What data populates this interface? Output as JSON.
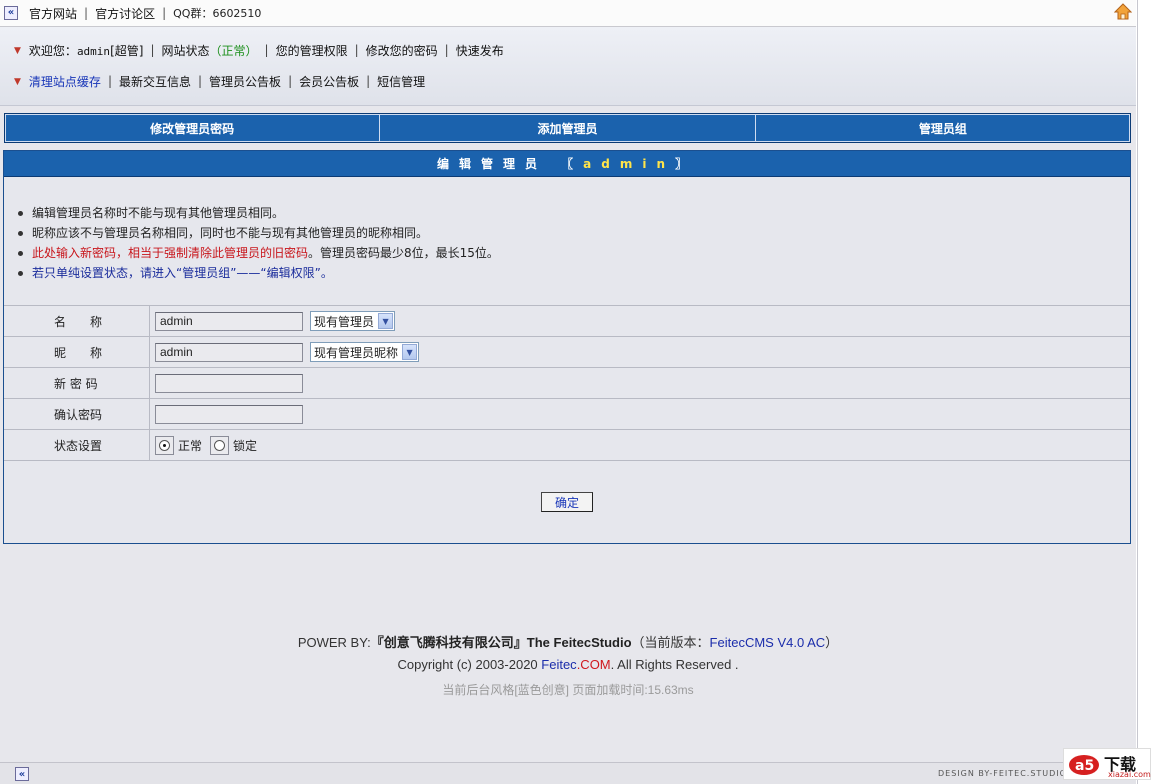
{
  "topbar": {
    "links": [
      "官方网站",
      "官方讨论区"
    ],
    "qq": "QQ群：6602510"
  },
  "nav": {
    "row1": {
      "welcome": "欢迎您：",
      "user": "admin",
      "role": "[超管]",
      "site_status_label": "网站状态",
      "site_status_value": "（正常）",
      "items": [
        "您的管理权限",
        "修改您的密码",
        "快速发布"
      ]
    },
    "row2": {
      "items": [
        "清理站点缓存",
        "最新交互信息",
        "管理员公告板",
        "会员公告板",
        "短信管理"
      ]
    }
  },
  "tabs": [
    "修改管理员密码",
    "添加管理员",
    "管理员组"
  ],
  "panel": {
    "title_prefix": "编辑管理员",
    "title_open": "〖",
    "title_name": "admin",
    "title_close": "〗"
  },
  "notes": {
    "n1": "编辑管理员名称时不能与现有其他管理员相同。",
    "n2": "昵称应该不与管理员名称相同，同时也不能与现有其他管理员的昵称相同。",
    "n3_red": "此处输入新密码，相当于强制清除此管理员的旧密码",
    "n3_rest": "。管理员密码最少8位，最长15位。",
    "n4": "若只单纯设置状态，请进入“管理员组”——“编辑权限”。"
  },
  "form": {
    "name_label": "名　　称",
    "name_value": "admin",
    "name_select": "现有管理员",
    "nick_label": "昵　　称",
    "nick_value": "admin",
    "nick_select": "现有管理员昵称",
    "newpass_label": "新 密 码",
    "newpass_value": "",
    "confirm_label": "确认密码",
    "confirm_value": "",
    "status_label": "状态设置",
    "status_normal": "正常",
    "status_locked": "锁定",
    "status_selected": "正常",
    "submit": "确定"
  },
  "footer": {
    "l1_prefix": "POWER BY:",
    "l1_company": "『创意飞腾科技有限公司』The FeitecStudio",
    "l1_version_prefix": "（当前版本：",
    "l1_version": "FeitecCMS V4.0 AC",
    "l1_version_suffix": "）",
    "l2_prefix": "Copyright (c) 2003-2020 ",
    "l2_brand": "Feitec",
    "l2_brand2": ".COM",
    "l2_suffix": ". All Rights Reserved .",
    "l3": "当前后台风格[蓝色创意] 页面加载时间:15.63ms"
  },
  "bottombar": {
    "design": "DESIGN BY-FEITEC.STUDIO"
  },
  "watermark": {
    "big": "下载",
    "small": "xiazai.com"
  },
  "colors": {
    "accent_blue": "#1b62ad",
    "title_name_yellow": "#ffe44a",
    "note_red": "#c8151b",
    "note_blue": "#1b2d9c",
    "status_green": "#1c8f1c"
  }
}
